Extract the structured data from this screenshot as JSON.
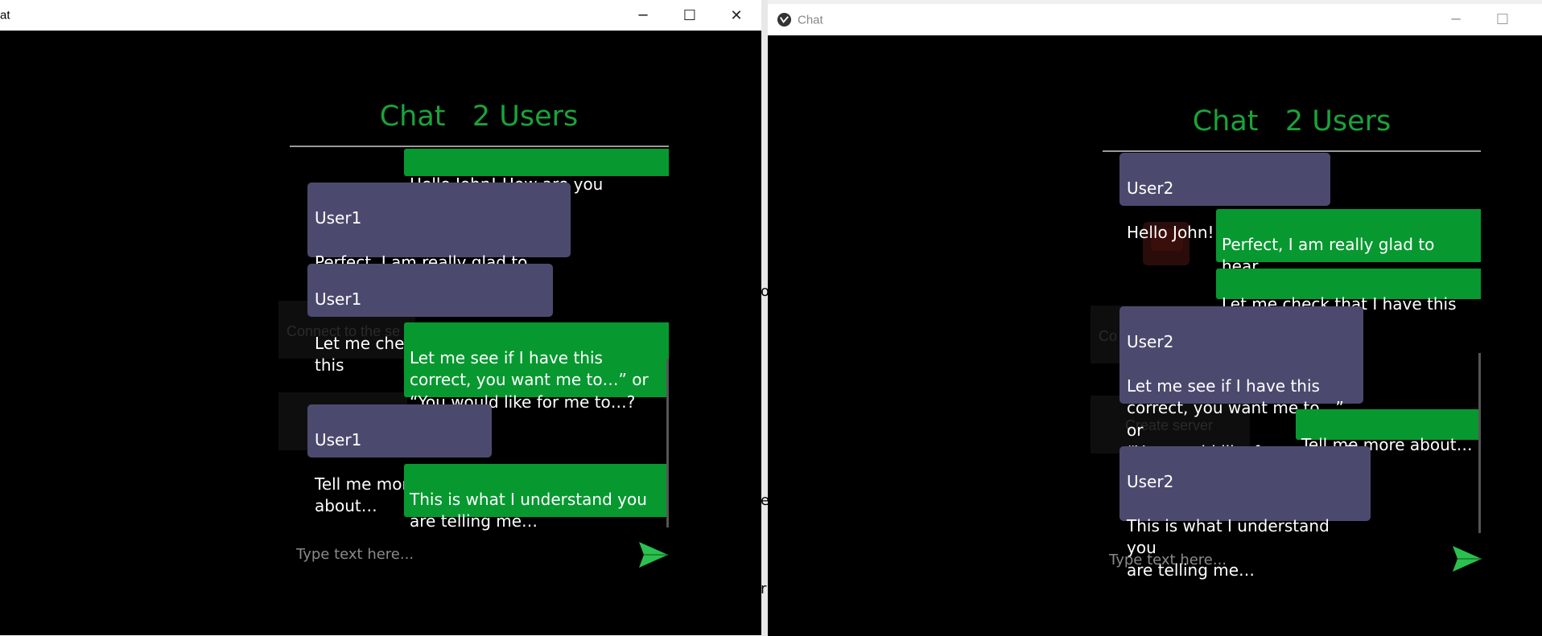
{
  "left_window": {
    "title": "at",
    "controls": {
      "minimize": "─",
      "maximize": "☐",
      "close": "✕"
    },
    "background_labels": [
      "Connect to the se"
    ],
    "chat_title": "Chat   2 Users",
    "messages": [
      {
        "type": "own",
        "text": "Hello John! How are you"
      },
      {
        "type": "other",
        "sender": "User1",
        "text": "Perfect, I am really glad to hear\nthat! How may I help you"
      },
      {
        "type": "other",
        "sender": "User1",
        "text": "Let me check that I have this"
      },
      {
        "type": "own",
        "text": "Let me see if I have this\ncorrect, you want me to…” or\n“You would like for me to…?"
      },
      {
        "type": "other",
        "sender": "User1",
        "text": "Tell me more about…"
      },
      {
        "type": "own",
        "text": "This is what I understand you\nare telling me…"
      }
    ],
    "input_placeholder": "Type text here...",
    "send_icon": "send-icon"
  },
  "right_window": {
    "title": "Chat",
    "app_icon": "kivy-logo-icon",
    "controls": {
      "minimize": "─",
      "maximize": "☐"
    },
    "background_labels": [
      "Co",
      "Create server"
    ],
    "chat_title": "Chat   2 Users",
    "messages": [
      {
        "type": "other",
        "sender": "User2",
        "text": "Hello John! How are you"
      },
      {
        "type": "own",
        "text": "Perfect, I am really glad to hear\nthat! How may I help you"
      },
      {
        "type": "own",
        "text": "Let me check that I have this"
      },
      {
        "type": "other",
        "sender": "User2",
        "text": "Let me see if I have this\ncorrect, you want me to…” or\n“You would like for me to…?"
      },
      {
        "type": "own",
        "text": "Tell me more about…"
      },
      {
        "type": "other",
        "sender": "User2",
        "text": "This is what I understand you\nare telling me…"
      }
    ],
    "input_placeholder": "Type text here...",
    "send_icon": "send-icon"
  },
  "edge_chars": [
    "o",
    "e",
    "r"
  ],
  "colors": {
    "own_bubble": "#079930",
    "other_bubble": "#4b4a6e",
    "title_green": "#1aa33a",
    "send_icon": "#2bc04f"
  }
}
